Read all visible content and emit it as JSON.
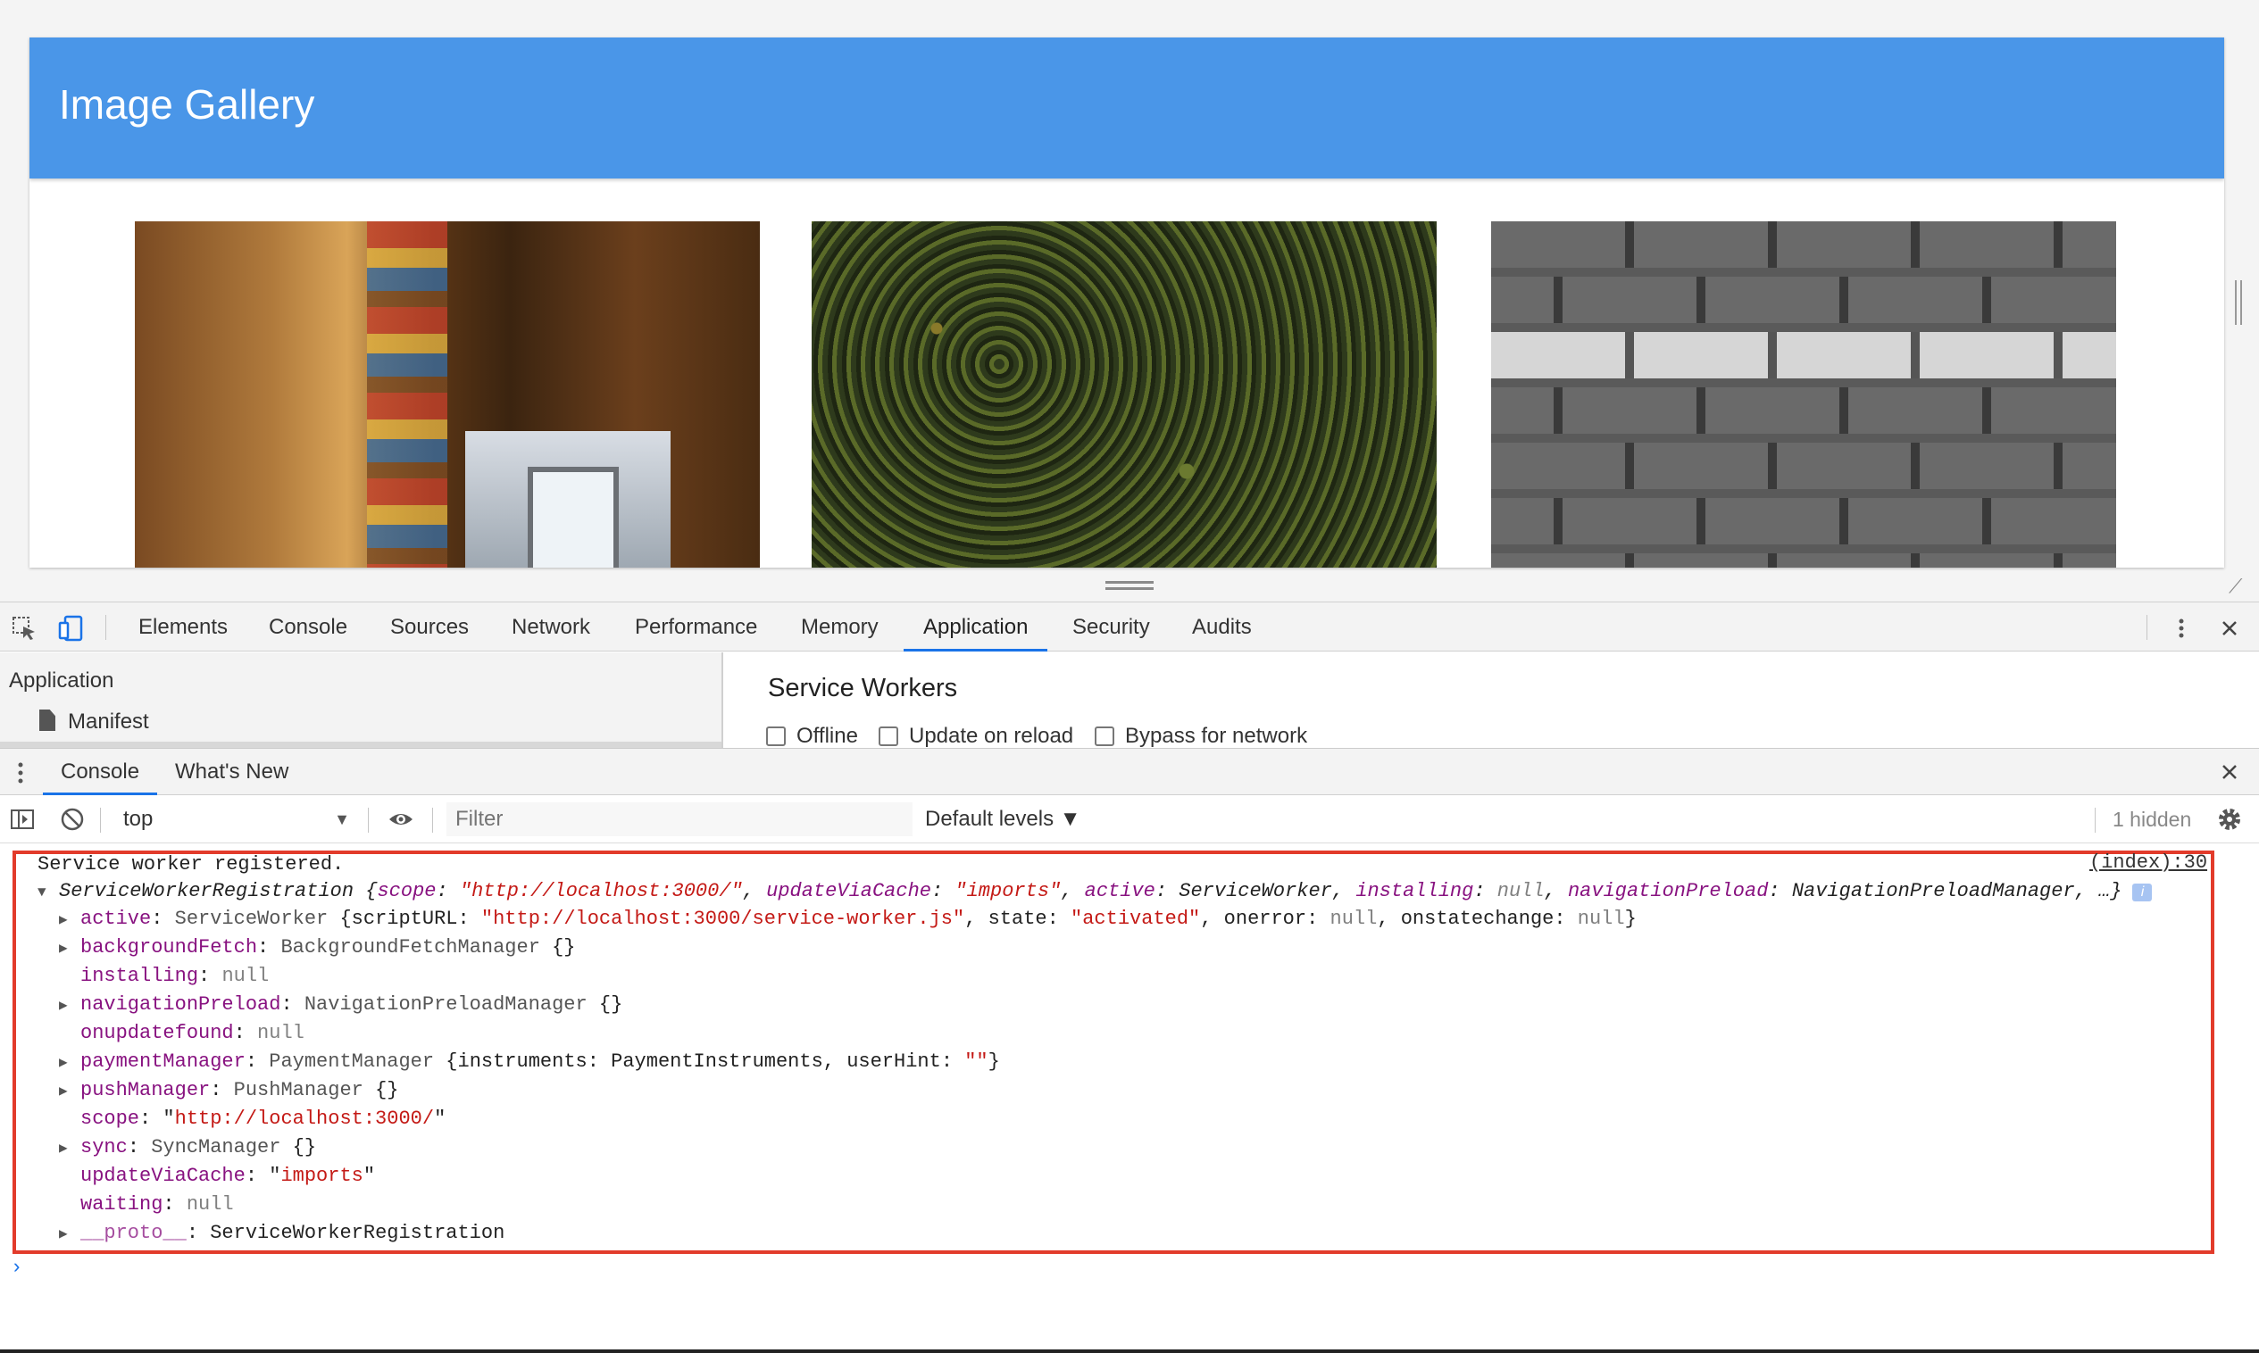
{
  "page": {
    "title": "Image Gallery",
    "photos": [
      "library-bookshelf-photo",
      "forest-aerial-photo",
      "brick-wall-photo"
    ]
  },
  "devtools": {
    "tabs": [
      "Elements",
      "Console",
      "Sources",
      "Network",
      "Performance",
      "Memory",
      "Application",
      "Security",
      "Audits"
    ],
    "active_tab": "Application",
    "icons": [
      "inspect-element-icon",
      "device-toolbar-icon",
      "more-vert-icon",
      "close-icon"
    ]
  },
  "application_panel": {
    "sidebar_heading": "Application",
    "sidebar_item": "Manifest",
    "section_title": "Service Workers",
    "checkboxes": [
      "Offline",
      "Update on reload",
      "Bypass for network"
    ]
  },
  "drawer": {
    "tabs": [
      "Console",
      "What's New"
    ],
    "active_tab": "Console"
  },
  "console_toolbar": {
    "context": "top",
    "filter_placeholder": "Filter",
    "levels": "Default levels ▼",
    "hidden": "1 hidden"
  },
  "console": {
    "message": "Service worker registered.",
    "source": "(index):30",
    "summary": {
      "type": "ServiceWorkerRegistration",
      "scope_key": "scope",
      "scope_val": "\"http://localhost:3000/\"",
      "cache_key": "updateViaCache",
      "cache_val": "\"imports\"",
      "active_key": "active",
      "active_val": "ServiceWorker",
      "installing_key": "installing",
      "installing_val": "null",
      "preload_key": "navigationPreload",
      "preload_val": "NavigationPreloadManager",
      "ellipsis": "…}"
    },
    "props": {
      "active": {
        "key": "active",
        "type": "ServiceWorker",
        "script_key": "scriptURL",
        "script_val": "\"http://localhost:3000/service-worker.js\"",
        "state_key": "state",
        "state_val": "\"activated\"",
        "onerror_key": "onerror",
        "onerror_val": "null",
        "onstate_key": "onstatechange",
        "onstate_val": "null"
      },
      "backgroundFetch": {
        "key": "backgroundFetch",
        "type": "BackgroundFetchManager",
        "val": "{}"
      },
      "installing": {
        "key": "installing",
        "val": "null"
      },
      "navigationPreload": {
        "key": "navigationPreload",
        "type": "NavigationPreloadManager",
        "val": "{}"
      },
      "onupdatefound": {
        "key": "onupdatefound",
        "val": "null"
      },
      "paymentManager": {
        "key": "paymentManager",
        "type": "PaymentManager",
        "inst_key": "instruments",
        "inst_val": "PaymentInstruments",
        "hint_key": "userHint",
        "hint_val": "\"\""
      },
      "pushManager": {
        "key": "pushManager",
        "type": "PushManager",
        "val": "{}"
      },
      "scope": {
        "key": "scope",
        "val": "http://localhost:3000/"
      },
      "sync": {
        "key": "sync",
        "type": "SyncManager",
        "val": "{}"
      },
      "updateViaCache": {
        "key": "updateViaCache",
        "val": "imports"
      },
      "waiting": {
        "key": "waiting",
        "val": "null"
      },
      "proto": {
        "key": "__proto__",
        "val": "ServiceWorkerRegistration"
      }
    }
  },
  "colors": {
    "header": "#4a96e8",
    "accent": "#1a73e8",
    "highlight_border": "#e23b2b",
    "property": "#881280",
    "string": "#c41a16"
  }
}
